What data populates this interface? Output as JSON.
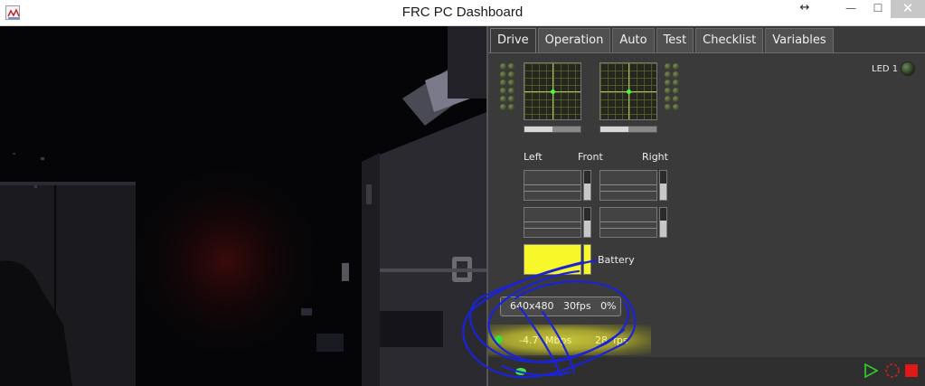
{
  "window": {
    "title": "FRC PC Dashboard",
    "resize_glyph": "↔",
    "minimize_glyph": "—",
    "maximize_glyph": "☐",
    "close_glyph": "✕"
  },
  "tabs": [
    {
      "label": "Drive",
      "active": true
    },
    {
      "label": "Operation",
      "active": false
    },
    {
      "label": "Auto",
      "active": false
    },
    {
      "label": "Test",
      "active": false
    },
    {
      "label": "Checklist",
      "active": false
    },
    {
      "label": "Variables",
      "active": false
    }
  ],
  "led1": {
    "label": "LED 1",
    "color": "#2f4524"
  },
  "joysticks": {
    "left": {
      "bar_level": 0.5
    },
    "right": {
      "bar_level": 0.5
    }
  },
  "motor_labels": {
    "left": "Left",
    "front": "Front",
    "right": "Right"
  },
  "battery": {
    "label": "Battery",
    "color": "#f7f72a",
    "level": 1.0
  },
  "camera": {
    "settings_label": "640x480   30fps   0%"
  },
  "status": {
    "bandwidth_value": "-4.7",
    "bandwidth_unit": "Mbps",
    "fps_value": "28",
    "fps_unit": "fps",
    "highlight_color": "#c9c43a"
  },
  "bottom_controls": {
    "play_icon": "play-icon",
    "record_icon": "record-icon",
    "stop_icon": "stop-icon"
  },
  "colors": {
    "panel_bg": "#3a3a3a",
    "led_green": "#3dff3d",
    "annotation_blue": "#1a23d8"
  }
}
